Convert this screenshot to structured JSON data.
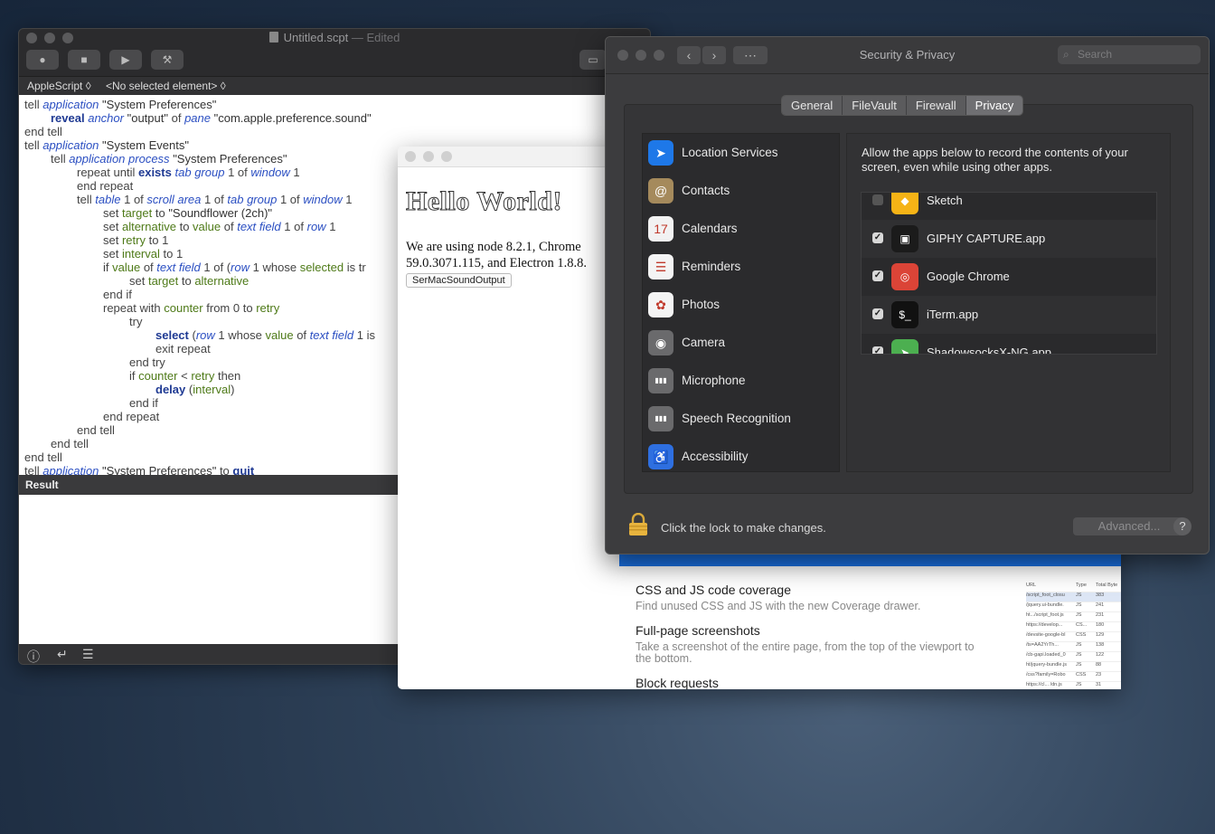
{
  "script_editor": {
    "title": "Untitled.scpt",
    "title_suffix": " — Edited",
    "language": "AppleScript ◊",
    "element_selector": "<No selected element> ◊",
    "result_label": "Result",
    "toolbar": {
      "record_icon": "record-icon",
      "stop_icon": "stop-icon",
      "run_icon": "run-icon",
      "compile_icon": "hammer-icon",
      "panel_icon": "panel-toggle-icon"
    },
    "bottom_icons": [
      "info-icon",
      "return-icon",
      "list-icon"
    ],
    "code_lines": [
      "tell application \"System Preferences\"",
      "reveal anchor \"output\" of pane \"com.apple.preference.sound\"",
      "end tell",
      "tell application \"System Events\"",
      "tell application process \"System Preferences\"",
      "repeat until exists tab group 1 of window 1",
      "end repeat",
      "tell table 1 of scroll area 1 of tab group 1 of window 1",
      "set target to \"Soundflower (2ch)\"",
      "set alternative to value of text field 1 of row 1",
      "set retry to 1",
      "set interval to 1",
      "if value of text field 1 of (row 1 whose selected is tr",
      "set target to alternative",
      "end if",
      "repeat with counter from 0 to retry",
      "try",
      "select (row 1 whose value of text field 1 is",
      "exit repeat",
      "end try",
      "if counter < retry then",
      "delay (interval)",
      "end if",
      "end repeat",
      "end tell",
      "end tell",
      "end tell",
      "tell application \"System Preferences\" to quit"
    ]
  },
  "hello_window": {
    "heading": "Hello World!",
    "paragraph": "We are using node 8.2.1, Chrome 59.0.3071.115, and Electron 1.8.8.",
    "button": "SerMacSoundOutput"
  },
  "devtools_whats_new": {
    "features": [
      {
        "title": "CSS and JS code coverage",
        "desc": "Find unused CSS and JS with the new Coverage drawer."
      },
      {
        "title": "Full-page screenshots",
        "desc": "Take a screenshot of the entire page, from the top of the viewport to the bottom."
      },
      {
        "title": "Block requests",
        "desc": ""
      }
    ],
    "thumb_headers": [
      "URL",
      "Type",
      "Total Byte"
    ],
    "thumb_rows": [
      [
        "/script_foot_closu",
        "JS",
        "383"
      ],
      [
        "/jquery.ui-bundle.",
        "JS",
        "241"
      ],
      [
        "ht.../script_foot.js",
        "JS",
        "231"
      ],
      [
        "https://develop...",
        "CS...",
        "180"
      ],
      [
        "/devsite-google-bl",
        "CSS",
        "129"
      ],
      [
        "/ts=AA2YrTh...",
        "JS",
        "138"
      ],
      [
        "/cb-gapi.loaded_0",
        "JS",
        "122"
      ],
      [
        "ht/jquery-bundle.js",
        "JS",
        "88"
      ],
      [
        "/css?family=Robo",
        "CSS",
        "23"
      ],
      [
        "https://cl... /dn.js",
        "JS",
        "31"
      ]
    ]
  },
  "security_privacy": {
    "title": "Security & Privacy",
    "search_placeholder": "Search",
    "tabs": [
      "General",
      "FileVault",
      "Firewall",
      "Privacy"
    ],
    "active_tab": "Privacy",
    "categories": [
      {
        "label": "Location Services",
        "icon": "location-arrow-icon",
        "color": "#1e78e8",
        "glyph": "➤"
      },
      {
        "label": "Contacts",
        "icon": "contacts-book-icon",
        "color": "#a58a5c",
        "glyph": "@"
      },
      {
        "label": "Calendars",
        "icon": "calendar-icon",
        "color": "#f2f2f2",
        "glyph": "17"
      },
      {
        "label": "Reminders",
        "icon": "reminders-list-icon",
        "color": "#f4f4f4",
        "glyph": "☰"
      },
      {
        "label": "Photos",
        "icon": "photos-flower-icon",
        "color": "#f4f4f4",
        "glyph": "✿"
      },
      {
        "label": "Camera",
        "icon": "camera-icon",
        "color": "#6a6a6c",
        "glyph": "◉"
      },
      {
        "label": "Microphone",
        "icon": "microphone-waveform-icon",
        "color": "#6a6a6c",
        "glyph": "▮▮▮"
      },
      {
        "label": "Speech Recognition",
        "icon": "speech-waveform-icon",
        "color": "#6a6a6c",
        "glyph": "▮▮▮"
      },
      {
        "label": "Accessibility",
        "icon": "accessibility-icon",
        "color": "#2e6fe0",
        "glyph": "♿"
      }
    ],
    "description": "Allow the apps below to record the contents of your screen, even while using other apps.",
    "apps": [
      {
        "name": "Sketch",
        "checked": false,
        "icon": "sketch-diamond-icon",
        "color": "#f5b316",
        "glyph": "◆"
      },
      {
        "name": "GIPHY CAPTURE.app",
        "checked": true,
        "icon": "giphy-capture-icon",
        "color": "#1b1b1b",
        "glyph": "▣"
      },
      {
        "name": "Google Chrome",
        "checked": true,
        "icon": "chrome-icon",
        "color": "#db4437",
        "glyph": "◎"
      },
      {
        "name": "iTerm.app",
        "checked": true,
        "icon": "iterm-terminal-icon",
        "color": "#111111",
        "glyph": "$_"
      },
      {
        "name": "ShadowsocksX-NG.app",
        "checked": true,
        "icon": "shadowsocks-icon",
        "color": "#4caf50",
        "glyph": "➤"
      }
    ],
    "lock_text": "Click the lock to make changes.",
    "advanced_button": "Advanced...",
    "help_button": "?"
  }
}
